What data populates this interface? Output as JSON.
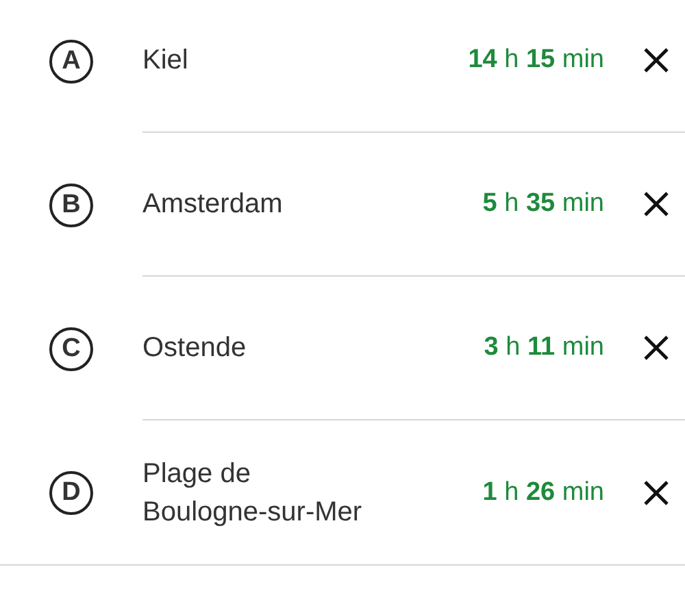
{
  "stops": [
    {
      "letter": "A",
      "name": "Kiel",
      "duration": "**14** h **15** min"
    },
    {
      "letter": "B",
      "name": "Amsterdam",
      "duration": "**5** h **35** min"
    },
    {
      "letter": "C",
      "name": "Ostende",
      "duration": "**3** h **11** min"
    },
    {
      "letter": "D",
      "name": "Plage de\nBoulogne-sur-Mer",
      "duration": "**1** h **26** min"
    }
  ]
}
